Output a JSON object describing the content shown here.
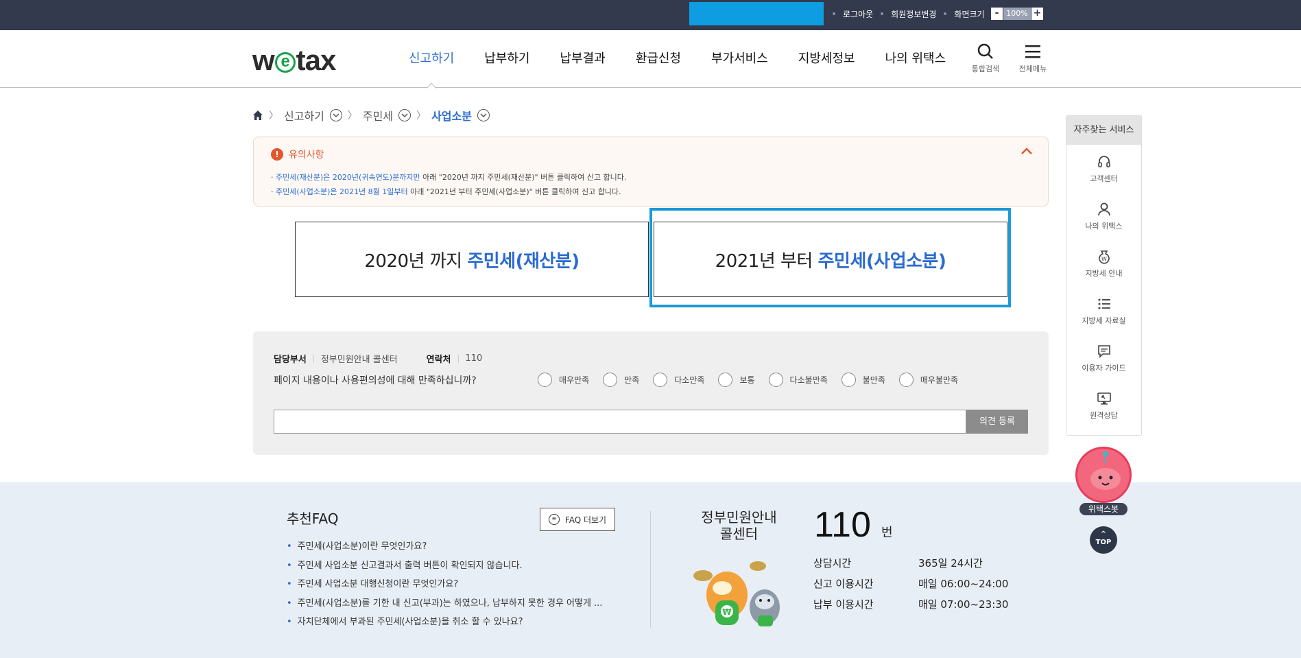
{
  "topbar": {
    "links": [
      "로그아웃",
      "회원정보변경",
      "화면크기"
    ],
    "zoom_minus": "-",
    "zoom_value": "100%",
    "zoom_plus": "+"
  },
  "header": {
    "logo_pre": "w",
    "logo_e": "e",
    "logo_post": "tax",
    "nav": [
      "신고하기",
      "납부하기",
      "납부결과",
      "환급신청",
      "부가서비스",
      "지방세정보",
      "나의 위택스"
    ],
    "search_label": "통합검색",
    "menu_label": "전체메뉴"
  },
  "breadcrumb": {
    "items": [
      "신고하기",
      "주민세",
      "사업소분"
    ]
  },
  "notice": {
    "title": "유의사항",
    "items": [
      {
        "hl": "주민세(재산분)은 2020년(귀속연도)분까지만",
        "rest": " 아래 \"2020년 까지 주민세(재산분)\" 버튼 클릭하여 신고 합니다."
      },
      {
        "hl": "주민세(사업소분)은 2021년 8월 1일부터",
        "rest": " 아래 \"2021년 부터 주민세(사업소분)\" 버튼 클릭하여 신고 합니다."
      }
    ]
  },
  "choices": [
    {
      "prefix": "2020년 까지 ",
      "bold": "주민세(재산분)"
    },
    {
      "prefix": "2021년 부터 ",
      "bold": "주민세(사업소분)"
    }
  ],
  "survey": {
    "dept_label": "담당부서",
    "dept_value": "정부민원안내 콜센터",
    "contact_label": "연락처",
    "contact_value": "110",
    "question": "페이지 내용이나 사용편의성에 대해 만족하십니까?",
    "options": [
      "매우만족",
      "만족",
      "다소만족",
      "보통",
      "다소불만족",
      "불만족",
      "매우불만족"
    ],
    "input_value": "",
    "submit_label": "의견 등록"
  },
  "footer": {
    "faq_title": "추천FAQ",
    "faq_more": "FAQ 더보기",
    "faq_items": [
      "주민세(사업소분)이란 무엇인가요?",
      "주민세 사업소분 신고결과서 출력 버튼이 확인되지 않습니다.",
      "주민세 사업소분 대행신청이란 무엇인가요?",
      "주민세(사업소분)를 기한 내 신고(부과)는 하였으나, 납부하지 못한 경우 어떻게 ...",
      "자치단체에서 부과된 주민세(사업소분)을 취소 할 수 있나요?"
    ],
    "callcenter_line1": "정부민원안내",
    "callcenter_line2": "콜센터",
    "callcenter_number": "110",
    "callcenter_unit": "번",
    "hours": [
      {
        "label": "상담시간",
        "value": "365일 24시간"
      },
      {
        "label": "신고 이용시간",
        "value": "매일 06:00~24:00"
      },
      {
        "label": "납부 이용시간",
        "value": "매일 07:00~23:30"
      }
    ]
  },
  "quick": {
    "title": "자주찾는 서비스",
    "items": [
      "고객센터",
      "나의 위택스",
      "지방세 안내",
      "지방세 자료실",
      "이용자 가이드",
      "원격상담"
    ]
  },
  "bot_label": "위택스봇",
  "top_label": "TOP",
  "colors": {
    "accent": "#2a6bd1",
    "topbar": "#333a4e",
    "highlight": "#1a9ad9",
    "notice": "#e2552d"
  }
}
